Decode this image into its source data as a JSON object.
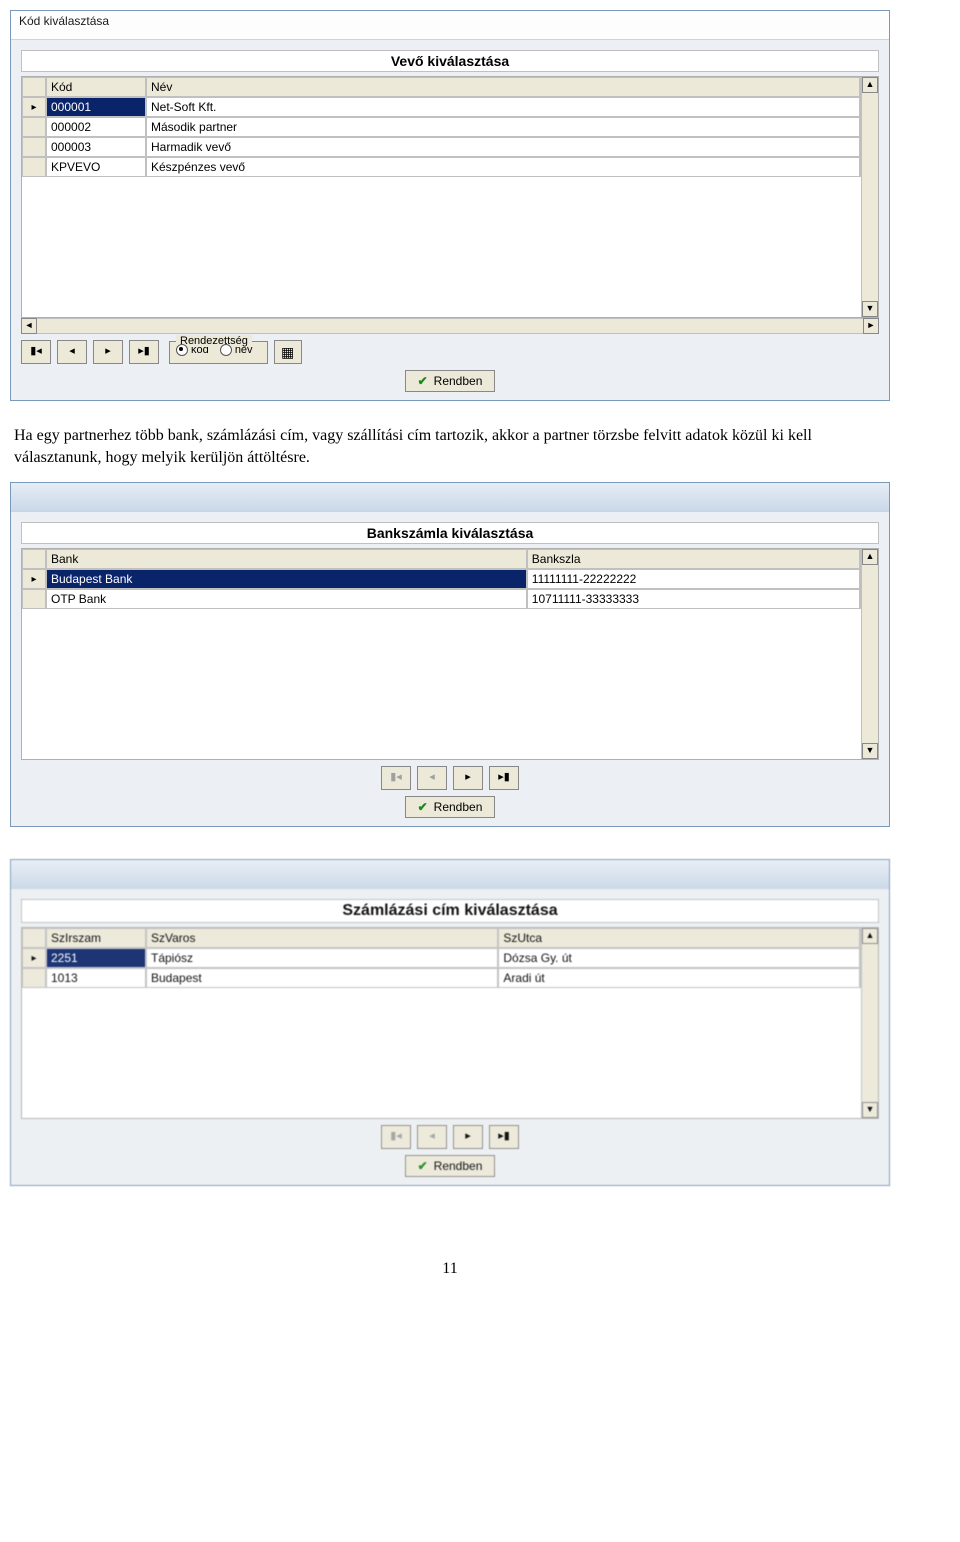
{
  "titlebar1": "Kód kiválasztása",
  "dlg1": {
    "title": "Vevő kiválasztása",
    "headers": [
      "Kód",
      "Név"
    ],
    "rows": [
      [
        "000001",
        "Net-Soft Kft."
      ],
      [
        "000002",
        "Második partner"
      ],
      [
        "000003",
        "Harmadik vevő"
      ],
      [
        "KPVEVO",
        "Készpénzes vevő"
      ]
    ],
    "sort_group": "Rendezettség",
    "radio_kod": "kód",
    "radio_nev": "név",
    "ok": "Rendben"
  },
  "paragraph": "Ha egy partnerhez több bank, számlázási cím, vagy szállítási cím tartozik, akkor a partner törzsbe felvitt adatok közül ki kell választanunk, hogy melyik kerüljön áttöltésre.",
  "dlg2": {
    "title": "Bankszámla kiválasztása",
    "headers": [
      "Bank",
      "Bankszla"
    ],
    "rows": [
      [
        "Budapest Bank",
        "11111111-22222222"
      ],
      [
        "OTP Bank",
        "10711111-33333333"
      ]
    ],
    "ok": "Rendben"
  },
  "dlg3": {
    "title": "Számlázási cím kiválasztása",
    "headers": [
      "SzIrszam",
      "SzVaros",
      "SzUtca"
    ],
    "rows": [
      [
        "2251",
        "Tápiósz",
        "Dózsa Gy. út"
      ],
      [
        "1013",
        "Budapest",
        "Aradi út"
      ]
    ],
    "ok": "Rendben"
  },
  "page_number": "11"
}
